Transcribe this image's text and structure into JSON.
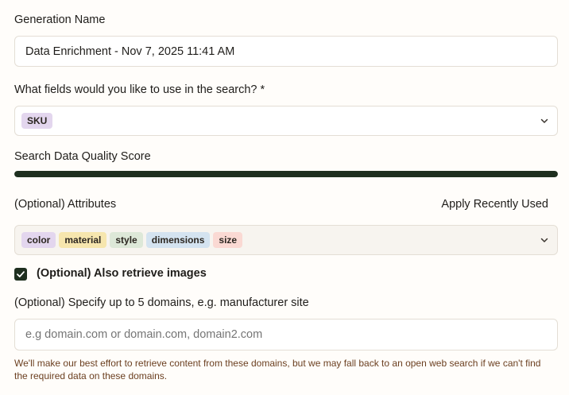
{
  "generation_name": {
    "label": "Generation Name",
    "value": "Data Enrichment - Nov 7, 2025 11:41 AM"
  },
  "search_fields": {
    "label": "What fields would you like to use in the search? *",
    "tags": [
      {
        "text": "SKU",
        "color": "#e3d6ee"
      }
    ],
    "icon": "chevron-down-icon"
  },
  "quality": {
    "label": "Search Data Quality Score",
    "progress": 1.0,
    "fill_color": "#1e2f1f"
  },
  "attributes": {
    "label": "(Optional) Attributes",
    "apply_recent": "Apply Recently Used",
    "tags": [
      {
        "text": "color",
        "color": "#e3d6ee"
      },
      {
        "text": "material",
        "color": "#f6e6ae"
      },
      {
        "text": "style",
        "color": "#dde8d8"
      },
      {
        "text": "dimensions",
        "color": "#d4e3f0"
      },
      {
        "text": "size",
        "color": "#fad9d3"
      }
    ],
    "icon": "chevron-down-icon"
  },
  "retrieve_images": {
    "label": "(Optional) Also retrieve images",
    "checked": true
  },
  "domains": {
    "label": "(Optional) Specify up to 5 domains, e.g. manufacturer site",
    "placeholder": "e.g domain.com or domain.com, domain2.com",
    "value": "",
    "help": "We'll make our best effort to retrieve content from these domains, but we may fall back to an open web search if we can't find the required data on these domains."
  }
}
